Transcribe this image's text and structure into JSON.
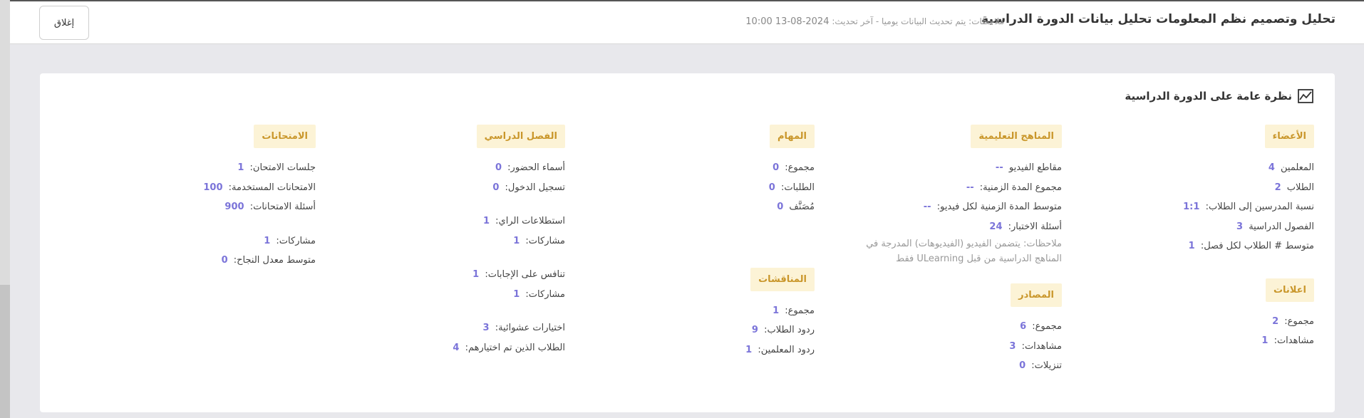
{
  "header": {
    "title": "تحليل وتصميم نظم المعلومات تحليل بيانات الدورة الدراسية",
    "notes_label": "ملاحظات: يتم تحديث البيانات يوميا - آخر تحديث:",
    "last_update": "2024-08-13 10:00",
    "close_label": "إغلاق"
  },
  "overview": {
    "title": "نظرة عامة على الدورة الدراسية",
    "icon": "line-chart-icon"
  },
  "members": {
    "heading": "الأعضاء",
    "rows": [
      {
        "label": "المعلمين",
        "value": "4"
      },
      {
        "label": "الطلاب",
        "value": "2"
      },
      {
        "label": "نسبة المدرسين إلى الطلاب:",
        "value": "1:1"
      },
      {
        "label": "الفصول الدراسية",
        "value": "3"
      },
      {
        "label": "متوسط # الطلاب لكل فصل:",
        "value": "1"
      }
    ]
  },
  "announcements": {
    "heading": "اعلانات",
    "rows": [
      {
        "label": "مجموع:",
        "value": "2"
      },
      {
        "label": "مشاهدات:",
        "value": "1"
      }
    ]
  },
  "curriculum": {
    "heading": "المناهج التعليمية",
    "rows": [
      {
        "label": "مقاطع الفيديو",
        "value": "--"
      },
      {
        "label": "مجموع المدة الزمنية:",
        "value": "--"
      },
      {
        "label": "متوسط المدة الزمنية لكل فيديو:",
        "value": "--"
      },
      {
        "label": "أسئلة الاختبار:",
        "value": "24"
      }
    ],
    "note": "ملاحظات: يتضمن الفيديو (الفيديوهات) المدرجة في المناهج الدراسية من قبل ULearning فقط"
  },
  "resources": {
    "heading": "المصادر",
    "rows": [
      {
        "label": "مجموع:",
        "value": "6"
      },
      {
        "label": "مشاهدات:",
        "value": "3"
      },
      {
        "label": "تنزيلات:",
        "value": "0"
      }
    ]
  },
  "tasks": {
    "heading": "المهام",
    "rows": [
      {
        "label": "مجموع:",
        "value": "0"
      },
      {
        "label": "الطلبات:",
        "value": "0"
      },
      {
        "label": "مُصَنَّف",
        "value": "0"
      }
    ]
  },
  "discussions": {
    "heading": "المناقشات",
    "rows": [
      {
        "label": "مجموع:",
        "value": "1"
      },
      {
        "label": "ردود الطلاب:",
        "value": "9"
      },
      {
        "label": "ردود المعلمين:",
        "value": "1"
      }
    ]
  },
  "classroom": {
    "heading": "الفصل الدراسي",
    "rows": [
      {
        "label": "أسماء الحضور:",
        "value": "0"
      },
      {
        "label": "تسجيل الدخول:",
        "value": "0"
      },
      {
        "label": "استطلاعات الراي:",
        "value": "1"
      },
      {
        "label": "مشاركات:",
        "value": "1"
      },
      {
        "label": "تنافس على الإجابات:",
        "value": "1"
      },
      {
        "label": "مشاركات:",
        "value": "1"
      },
      {
        "label": "اختيارات عشوائية:",
        "value": "3"
      },
      {
        "label": "الطلاب الذين تم اختيارهم:",
        "value": "4"
      }
    ]
  },
  "exams": {
    "heading": "الامتحانات",
    "rows": [
      {
        "label": "جلسات الامتحان:",
        "value": "1"
      },
      {
        "label": "الامتحانات المستخدمة:",
        "value": "100"
      },
      {
        "label": "أسئلة الامتحانات:",
        "value": "900"
      },
      {
        "label": "مشاركات:",
        "value": "1"
      },
      {
        "label": "متوسط معدل النجاح:",
        "value": "0"
      }
    ]
  }
}
